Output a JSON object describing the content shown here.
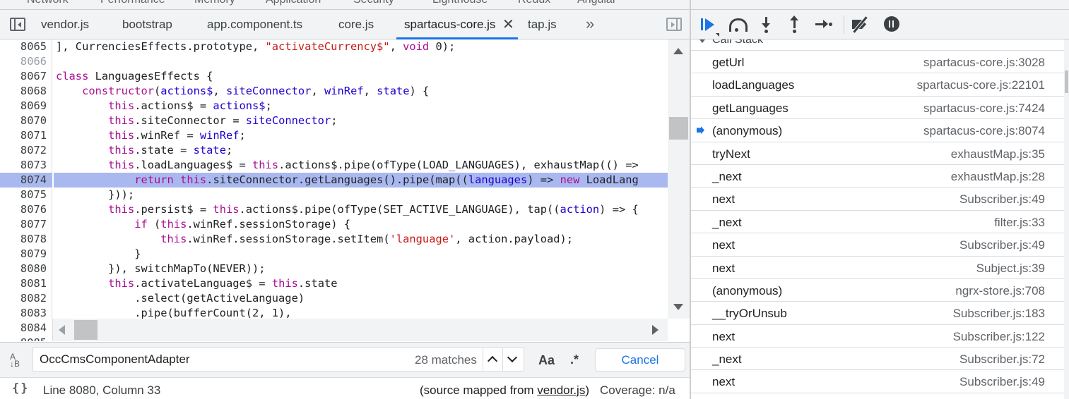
{
  "top_tabs": [
    "Network",
    "Performance",
    "Memory",
    "Application",
    "Security",
    "Lighthouse",
    "Redux",
    "Angular"
  ],
  "file_tabs": [
    {
      "label": "vendor.js"
    },
    {
      "label": "bootstrap"
    },
    {
      "label": "app.component.ts"
    },
    {
      "label": "core.js"
    },
    {
      "label": "spartacus-core.js",
      "active": true
    },
    {
      "label": "tap.js"
    }
  ],
  "more_tabs_label": "»",
  "code": {
    "highlight_line": "8074",
    "lines": [
      {
        "n": "8065",
        "t": "], CurrenciesEffects.prototype, \"activateCurrency$\", void 0);"
      },
      {
        "n": "8066",
        "t": ""
      },
      {
        "n": "8067",
        "t": "class LanguagesEffects {"
      },
      {
        "n": "8068",
        "t": "    constructor(actions$, siteConnector, winRef, state) {"
      },
      {
        "n": "8069",
        "t": "        this.actions$ = actions$;"
      },
      {
        "n": "8070",
        "t": "        this.siteConnector = siteConnector;"
      },
      {
        "n": "8071",
        "t": "        this.winRef = winRef;"
      },
      {
        "n": "8072",
        "t": "        this.state = state;"
      },
      {
        "n": "8073",
        "t": "        this.loadLanguages$ = this.actions$.pipe(ofType(LOAD_LANGUAGES), exhaustMap(() =>"
      },
      {
        "n": "8074",
        "t": "            return this.siteConnector.getLanguages().pipe(map((languages) => new LoadLang"
      },
      {
        "n": "8075",
        "t": "        }));"
      },
      {
        "n": "8076",
        "t": "        this.persist$ = this.actions$.pipe(ofType(SET_ACTIVE_LANGUAGE), tap((action) => {"
      },
      {
        "n": "8077",
        "t": "            if (this.winRef.sessionStorage) {"
      },
      {
        "n": "8078",
        "t": "                this.winRef.sessionStorage.setItem('language', action.payload);"
      },
      {
        "n": "8079",
        "t": "            }"
      },
      {
        "n": "8080",
        "t": "        }), switchMapTo(NEVER));"
      },
      {
        "n": "8081",
        "t": "        this.activateLanguage$ = this.state"
      },
      {
        "n": "8082",
        "t": "            .select(getActiveLanguage)"
      },
      {
        "n": "8083",
        "t": "            .pipe(bufferCount(2, 1),"
      }
    ],
    "trailing_lines": [
      "8084",
      "8085"
    ]
  },
  "search": {
    "value": "OccCmsComponentAdapter",
    "placeholder": "Find",
    "match_count": "28 matches",
    "case_label": "Aa",
    "regex_label": ".*",
    "case_icon_top": "A",
    "case_icon_bottom": "↓B",
    "cancel_label": "Cancel"
  },
  "status": {
    "braces_icon": "{}",
    "cursor": "Line 8080, Column 33",
    "mapped_prefix": "(source mapped from ",
    "mapped_file": "vendor.js",
    "mapped_suffix": ")",
    "coverage": "Coverage: n/a"
  },
  "call_stack": {
    "header": "Call Stack",
    "frames": [
      {
        "name": "getUrl",
        "location": "spartacus-core.js:3028"
      },
      {
        "name": "loadLanguages",
        "location": "spartacus-core.js:22101"
      },
      {
        "name": "getLanguages",
        "location": "spartacus-core.js:7424"
      },
      {
        "name": "(anonymous)",
        "location": "spartacus-core.js:8074",
        "current": true
      },
      {
        "name": "tryNext",
        "location": "exhaustMap.js:35"
      },
      {
        "name": "_next",
        "location": "exhaustMap.js:28"
      },
      {
        "name": "next",
        "location": "Subscriber.js:49"
      },
      {
        "name": "_next",
        "location": "filter.js:33"
      },
      {
        "name": "next",
        "location": "Subscriber.js:49"
      },
      {
        "name": "next",
        "location": "Subject.js:39"
      },
      {
        "name": "(anonymous)",
        "location": "ngrx-store.js:708"
      },
      {
        "name": "__tryOrUnsub",
        "location": "Subscriber.js:183"
      },
      {
        "name": "next",
        "location": "Subscriber.js:122"
      },
      {
        "name": "_next",
        "location": "Subscriber.js:72"
      },
      {
        "name": "next",
        "location": "Subscriber.js:49"
      }
    ]
  },
  "colors": {
    "accent": "#1a73e8",
    "highlight": "#a9b9f0",
    "keyword": "#aa0d91",
    "string": "#c41a16",
    "identifier": "#1c00cf"
  }
}
